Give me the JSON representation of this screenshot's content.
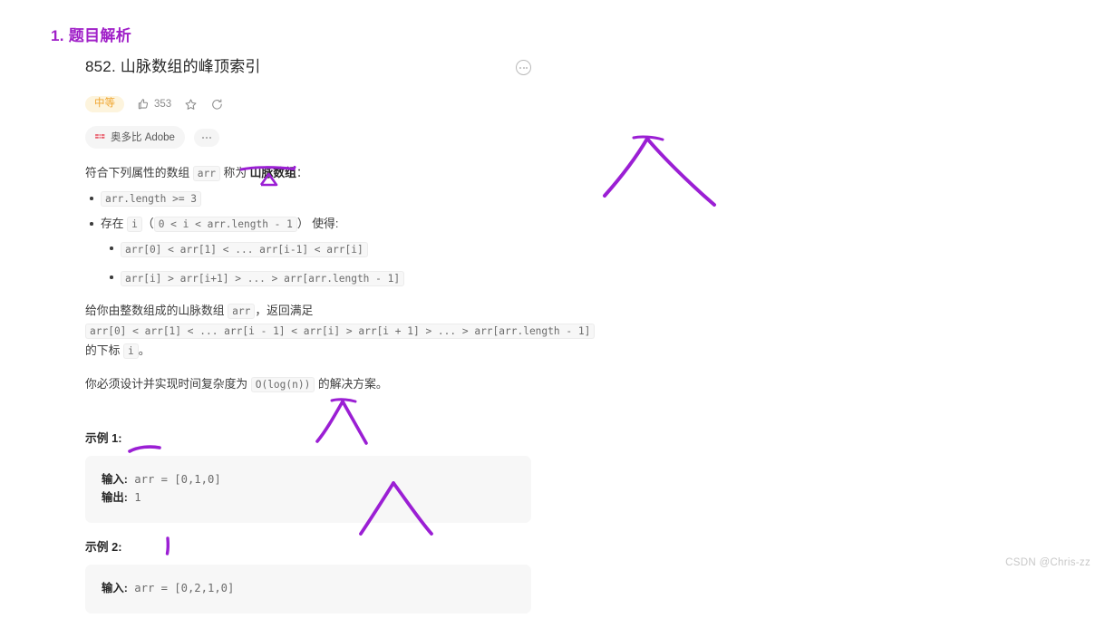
{
  "section": {
    "heading": "1. 题目解析",
    "heading_color": "#a020c8"
  },
  "problem": {
    "title": "852. 山脉数组的峰顶索引",
    "options_icon": "circle-ellipsis-icon",
    "difficulty": "中等",
    "difficulty_color": "#f0a631",
    "likes": "353",
    "like_icon": "thumbs-up-icon",
    "favorite_icon": "star-icon",
    "share_icon": "share-icon",
    "tags": [
      {
        "icon": "adobe-logo-icon",
        "label": "奥多比 Adobe"
      }
    ],
    "more_tags_icon": "ellipsis-icon"
  },
  "description": {
    "intro_prefix": "符合下列属性的数组",
    "intro_code": "arr",
    "intro_mid": "称为",
    "intro_term": "山脉数组",
    "intro_suffix": "：",
    "bullet1_code": "arr.length >= 3",
    "bullet2_prefix": "存在",
    "bullet2_code_i": "i",
    "bullet2_open": "（",
    "bullet2_code_range": "0 < i < arr.length - 1",
    "bullet2_close": "）",
    "bullet2_suffix": "使得:",
    "sub1_code": "arr[0] < arr[1] < ... arr[i-1] < arr[i]",
    "sub2_code": "arr[i] > arr[i+1] > ... > arr[arr.length - 1]",
    "para1_a": "给你由整数组成的山脉数组",
    "para1_code1": "arr",
    "para1_b": "，返回满足",
    "para1_code2": "arr[0] < arr[1] < ... arr[i - 1] < arr[i] > arr[i + 1] > ... > arr[arr.length - 1]",
    "para1_c": "的下标",
    "para1_code3": "i",
    "para1_d": "。",
    "para2_a": "你必须设计并实现时间复杂度为",
    "para2_code": "O(log(n))",
    "para2_b": "的解决方案。"
  },
  "examples": [
    {
      "label": "示例 1:",
      "input_label": "输入:",
      "input_value": "arr = [0,1,0]",
      "output_label": "输出:",
      "output_value": "1"
    },
    {
      "label": "示例 2:",
      "input_label": "输入:",
      "input_value": "arr = [0,2,1,0]"
    }
  ],
  "annotations": {
    "ink_color": "#9b1fd4",
    "items": [
      {
        "name": "underline-mountain-array",
        "kind": "underline-with-triangle"
      },
      {
        "name": "mountain-sketch-large",
        "kind": "mountain-peak"
      },
      {
        "name": "mountain-sketch-example1",
        "kind": "mountain-peak"
      },
      {
        "name": "mountain-sketch-example2",
        "kind": "mountain-peak"
      },
      {
        "name": "underline-output-value",
        "kind": "underline"
      },
      {
        "name": "index-tick-mark",
        "kind": "vertical-tick"
      }
    ]
  },
  "watermark": {
    "text": "CSDN @Chris-zz"
  }
}
